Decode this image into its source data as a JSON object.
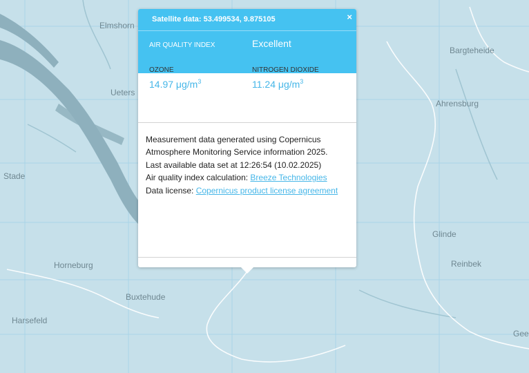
{
  "map": {
    "places": {
      "elmshorn": "Elmshorn",
      "bargteheide": "Bargteheide",
      "uetersen": "Ueters",
      "ahrensburg": "Ahrensburg",
      "stade": "Stade",
      "glinde": "Glinde",
      "reinbek": "Reinbek",
      "horneburg": "Horneburg",
      "buxtehude": "Buxtehude",
      "harsefeld": "Harsefeld",
      "geesthacht": "Gees"
    },
    "colors": {
      "land": "#c6e0ea",
      "water": "#8eb0bd",
      "grid": "#a9d4e8",
      "border": "#ffffff"
    }
  },
  "popup": {
    "title": "Satellite data: 53.499534, 9.875105",
    "close": "×",
    "aqi_label": "AIR QUALITY INDEX",
    "aqi_value": "Excellent",
    "pollutants": [
      {
        "name": "OZONE",
        "value": "14.97 μg/m",
        "sup": "3"
      },
      {
        "name": "NITROGEN DIOXIDE",
        "value": "11.24 μg/m",
        "sup": "3"
      }
    ],
    "info": {
      "line1": "Measurement data generated using Copernicus Atmosphere Monitoring Service information 2025.",
      "line2": "Last available data set at 12:26:54 (10.02.2025)",
      "aqi_calc_label": "Air quality index calculation: ",
      "aqi_calc_link": "Breeze Technologies",
      "license_label": "Data license: ",
      "license_link": "Copernicus product license agreement"
    },
    "colors": {
      "header": "#45c2f1",
      "value": "#45b6e8"
    }
  }
}
